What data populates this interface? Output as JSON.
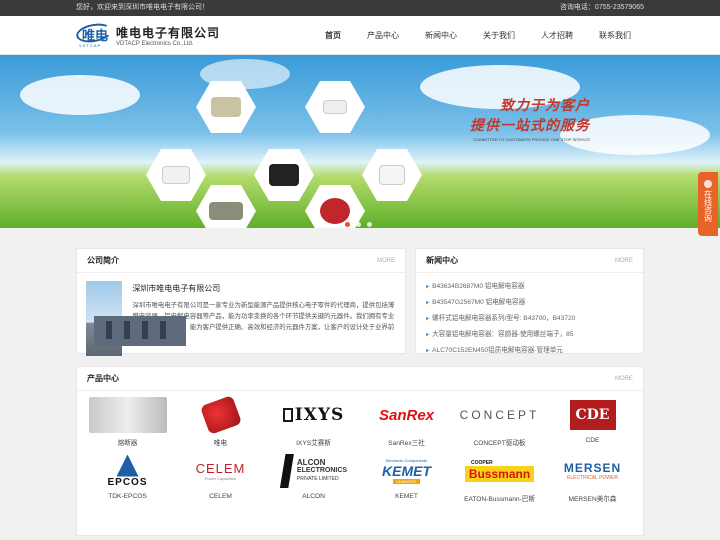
{
  "topbar": {
    "welcome": "您好，欢迎来到深圳市唯电电子有限公司！",
    "phone": "咨询电话：0755-23579065"
  },
  "logo": {
    "cn": "唯电电子有限公司",
    "en": "VDTACP Electronics Co.,Ltd.",
    "mark": "唯电",
    "mark_sub": "VDTCAP"
  },
  "nav": [
    "首页",
    "产品中心",
    "新闻中心",
    "关于我们",
    "人才招聘",
    "联系我们"
  ],
  "banner": {
    "line1": "致力于为客户",
    "line2": "提供一站式的服务",
    "line3": "COMMITTED TO CUSTOMERS PROVIDE ONE STOP SERVICE"
  },
  "online": "在线咨询",
  "about": {
    "title": "公司简介",
    "more": "MORE",
    "heading": "深圳市唯电电子有限公司",
    "text": "深圳市唯电电子有限公司是一家专业为新型能源产品提供核心电子零件的代理商，提供包括薄膜电容器、铝电解电容器等产品，能为功率变换的各个环节提供关键的元器件。我们拥有专业的销售工程师团队，能为客户提供正确、高效和经济的元器件方案，让客户的设计处于业界前沿。"
  },
  "news": {
    "title": "新闻中心",
    "more": "MORE",
    "items": [
      "B43634B2687M0 铝电解电容器",
      "B43547G2567M0 铝电解电容器",
      "螺杆式铝电解电容器系列/型号: B43700，B43720",
      "大容量铝电解电容器：容颜器-使用螺丝端子，85",
      "ALC70C152EN450铝质电解电容器-管理单元"
    ]
  },
  "products": {
    "title": "产品中心",
    "more": "MORE",
    "items": [
      {
        "label": "熔断器",
        "logo": "fuse-photo"
      },
      {
        "label": "唯电",
        "logo": "red-capacitor"
      },
      {
        "label": "IXYS艾赛斯",
        "logo": "IXYS"
      },
      {
        "label": "SanRex三社",
        "logo": "SanRex"
      },
      {
        "label": "CONCEPT驱动板",
        "logo": "CONCEPT"
      },
      {
        "label": "CDE",
        "logo": "CDE"
      },
      {
        "label": "TDK-EPCOS",
        "logo": "EPCOS"
      },
      {
        "label": "CELEM",
        "logo": "CELEM"
      },
      {
        "label": "ALCON",
        "logo": "ALCON ELECTRONICS"
      },
      {
        "label": "KEMET",
        "logo": "KEMET"
      },
      {
        "label": "EATON-Bussmann-巴斯",
        "logo": "Bussmann"
      },
      {
        "label": "MERSEN美尔森",
        "logo": "MERSEN"
      }
    ],
    "logo_text": {
      "ixys": "IXYS",
      "sanrex": "SanRex",
      "concept": "CONCEPT",
      "cde": "CDE",
      "epcos": "EPCOS",
      "celem": "CELEM",
      "celem_sub": "Power Capacitors",
      "alcon1": "ALCON",
      "alcon2": "ELECTRONICS",
      "alcon3": "PRIVATE LIMITED",
      "kemet_top": "Electronic Components",
      "kemet": "KEMET",
      "kemet_sub": "CHARGED.",
      "cooper": "COOPER",
      "bussmann": "Bussmann",
      "mersen": "MERSEN",
      "mersen_sub": "ELECTRICAL POWER"
    }
  },
  "colors": {
    "accent": "#c0392b",
    "link": "#2a7fc0",
    "online": "#e8632a"
  }
}
